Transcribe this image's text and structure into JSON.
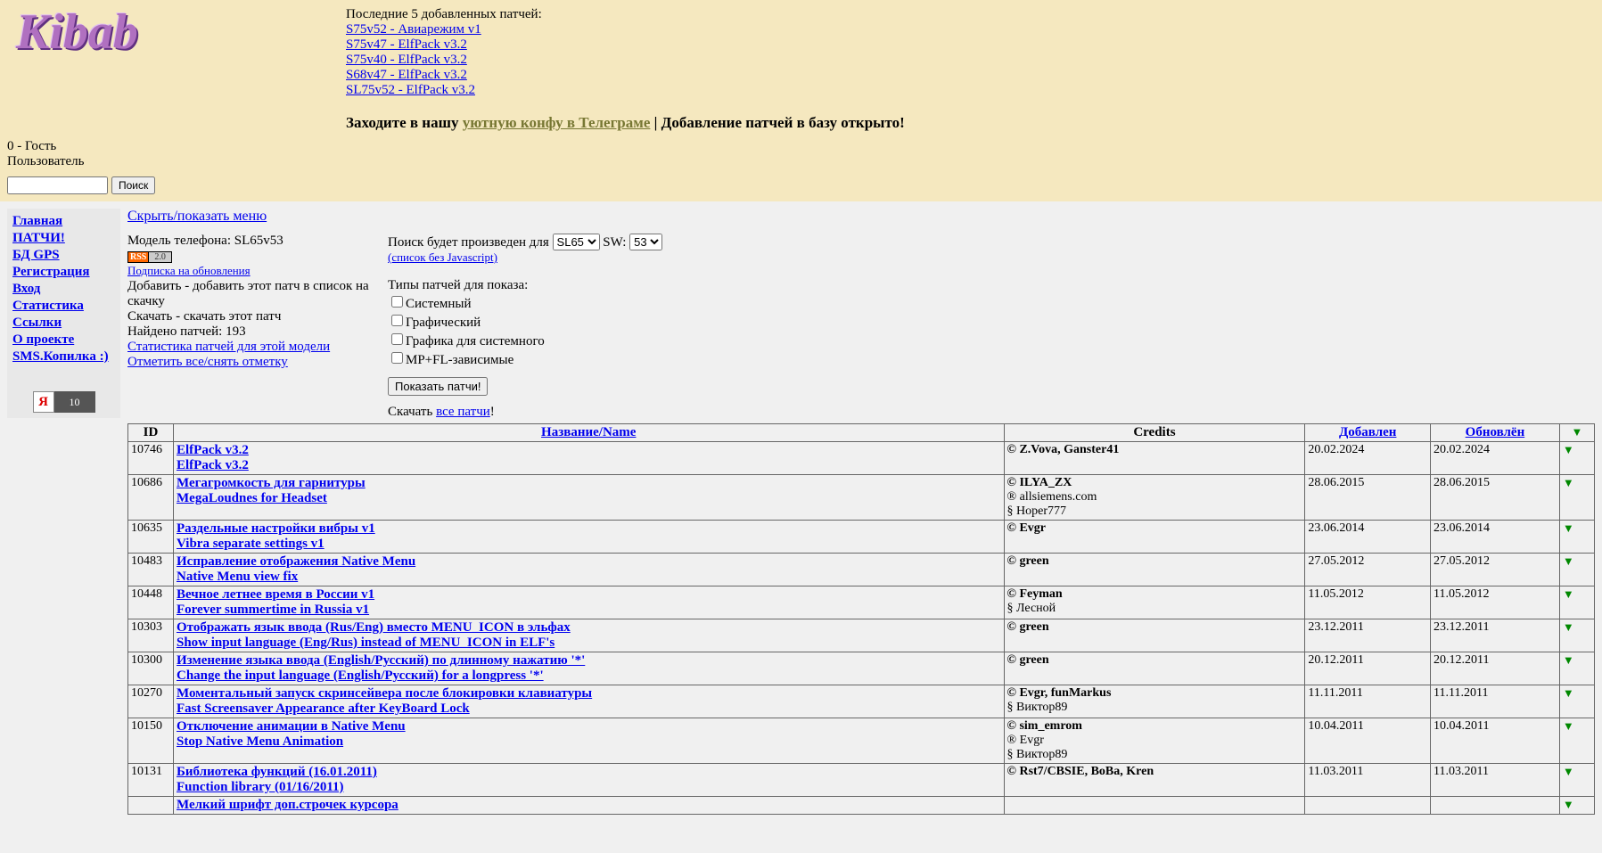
{
  "header": {
    "recent_label": "Последние 5 добавленных патчей:",
    "recent": [
      "S75v52 - Авиарежим v1",
      "S75v47 - ElfPack v3.2",
      "S75v40 - ElfPack v3.2",
      "S68v47 - ElfPack v3.2",
      "SL75v52 - ElfPack v3.2"
    ],
    "welcome_prefix": "Заходите в нашу ",
    "welcome_link": "уютную конфу в Телеграме",
    "welcome_suffix": " | Добавление патчей в базу открыто!"
  },
  "user": {
    "left": "0 - Гость",
    "right": "Пользователь"
  },
  "search_btn": "Поиск",
  "sidebar": {
    "items": [
      "Главная",
      "ПАТЧИ!",
      "БД GPS",
      "Регистрация",
      "Вход",
      "Статистика",
      "Ссылки",
      "О проекте",
      "SMS.Копилка :)"
    ],
    "ya_num": "10"
  },
  "controls": {
    "toggle_menu": "Скрыть/показать меню",
    "model_label": "Модель телефона: SL65v53",
    "rss_sub": "Подписка на обновления",
    "add_hint": "Добавить - добавить этот патч в список на скачку",
    "dl_hint": "Скачать - скачать этот патч",
    "found": "Найдено патчей: 193",
    "stats_link": "Статистика патчей для этой модели",
    "mark_link": "Отметить все/снять отметку",
    "search_label_pre": "Поиск будет произведен для ",
    "model_sel": "SL65",
    "sw_label": " SW: ",
    "sw_sel": "53",
    "nojs_link": "(список без Javascript)",
    "types_label": "Типы патчей для показа:",
    "cb": [
      "Системный",
      "Графический",
      "Графика для системного",
      "MP+FL-зависимые"
    ],
    "show_btn": "Показать патчи!",
    "dl_all_pre": "Скачать ",
    "dl_all_link": "все патчи",
    "dl_all_suf": "!"
  },
  "table": {
    "headers": {
      "id": "ID",
      "name": "Название/Name",
      "credits": "Credits",
      "added": "Добавлен",
      "updated": "Обновлён"
    },
    "rows": [
      {
        "id": "10746",
        "ru": "ElfPack v3.2",
        "en": "ElfPack v3.2",
        "credits": [
          "© Z.Vova, Ganster41"
        ],
        "added": "20.02.2024",
        "updated": "20.02.2024"
      },
      {
        "id": "10686",
        "ru": "Мегагромкость для гарнитуры",
        "en": "MegaLoudnes for Headset",
        "credits": [
          "© ILYA_ZX",
          "® allsiemens.com",
          "§ Hoper777"
        ],
        "added": "28.06.2015",
        "updated": "28.06.2015"
      },
      {
        "id": "10635",
        "ru": "Раздельные настройки вибры v1",
        "en": "Vibra separate settings v1",
        "credits": [
          "© Evgr"
        ],
        "added": "23.06.2014",
        "updated": "23.06.2014"
      },
      {
        "id": "10483",
        "ru": "Исправление отображения Native Menu",
        "en": "Native Menu view fix",
        "credits": [
          "© green"
        ],
        "added": "27.05.2012",
        "updated": "27.05.2012"
      },
      {
        "id": "10448",
        "ru": "Вечное летнее время в России v1",
        "en": "Forever summertime in Russia v1",
        "credits": [
          "© Feyman",
          "§ Лесной"
        ],
        "added": "11.05.2012",
        "updated": "11.05.2012"
      },
      {
        "id": "10303",
        "ru": "Отображать язык ввода (Rus/Eng) вместо MENU_ICON в эльфах",
        "en": "Show input language (Eng/Rus) instead of MENU_ICON in ELF's",
        "credits": [
          "© green"
        ],
        "added": "23.12.2011",
        "updated": "23.12.2011"
      },
      {
        "id": "10300",
        "ru": "Изменение языка ввода (English/Русский) по длинному нажатию '*'",
        "en": "Change the input language (English/Русский) for a longpress '*'",
        "credits": [
          "© green"
        ],
        "added": "20.12.2011",
        "updated": "20.12.2011"
      },
      {
        "id": "10270",
        "ru": "Моментальный запуск скринсейвера после блокировки клавиатуры",
        "en": "Fast Screensaver Appearance after KeyBoard Lock",
        "credits": [
          "© Evgr, funMarkus",
          "§ Виктор89"
        ],
        "added": "11.11.2011",
        "updated": "11.11.2011"
      },
      {
        "id": "10150",
        "ru": "Отключение анимации в Native Menu",
        "en": "Stop Native Menu Animation",
        "credits": [
          "© sim_emrom",
          "® Evgr",
          "§ Виктор89"
        ],
        "added": "10.04.2011",
        "updated": "10.04.2011"
      },
      {
        "id": "10131",
        "ru": "Библиотека функций (16.01.2011)",
        "en": "Function library (01/16/2011)",
        "credits": [
          "© Rst7/CBSIE, BoBa, Kren"
        ],
        "added": "11.03.2011",
        "updated": "11.03.2011"
      },
      {
        "id": "",
        "ru": "Мелкий шрифт доп.строчек курсора",
        "en": "",
        "credits": [],
        "added": "",
        "updated": ""
      }
    ]
  }
}
